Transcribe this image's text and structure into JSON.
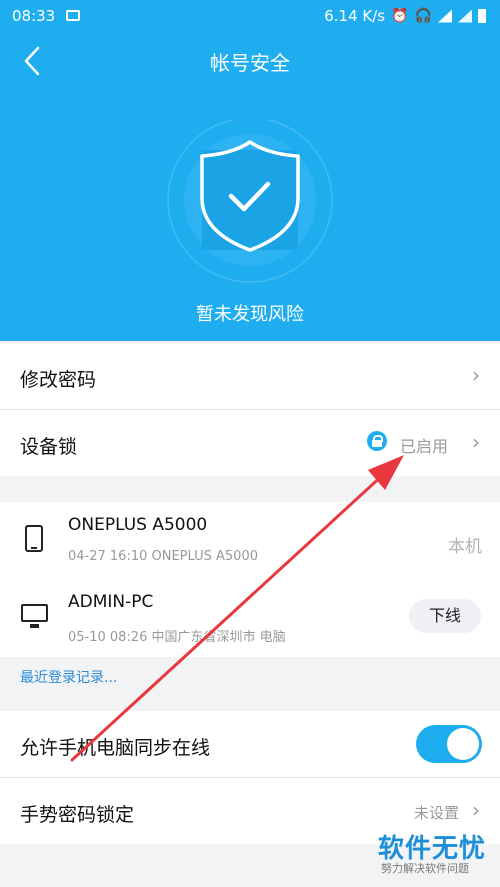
{
  "status_bar": {
    "time": "08:33",
    "speed": "6.14 K/s"
  },
  "header": {
    "title": "帐号安全",
    "risk_text": "暂未发现风险"
  },
  "menu": {
    "change_password": "修改密码",
    "device_lock": {
      "label": "设备锁",
      "status": "已启用"
    }
  },
  "devices": [
    {
      "name": "ONEPLUS A5000",
      "info": "04-27 16:10 ONEPLUS A5000",
      "tag": "本机"
    },
    {
      "name": "ADMIN-PC",
      "info": "05-10 08:26 中国广东省深圳市 电脑",
      "action": "下线"
    }
  ],
  "recent_login": "最近登录记录...",
  "sync_online": {
    "label": "允许手机电脑同步在线",
    "enabled": true
  },
  "gesture_lock": {
    "label": "手势密码锁定",
    "status": "未设置"
  },
  "watermark": {
    "main": "软件无忧",
    "sub": "努力解决软件问题"
  },
  "colors": {
    "primary": "#1eaef0",
    "annotation_arrow": "#e8383d",
    "link": "#2b8bd8"
  }
}
